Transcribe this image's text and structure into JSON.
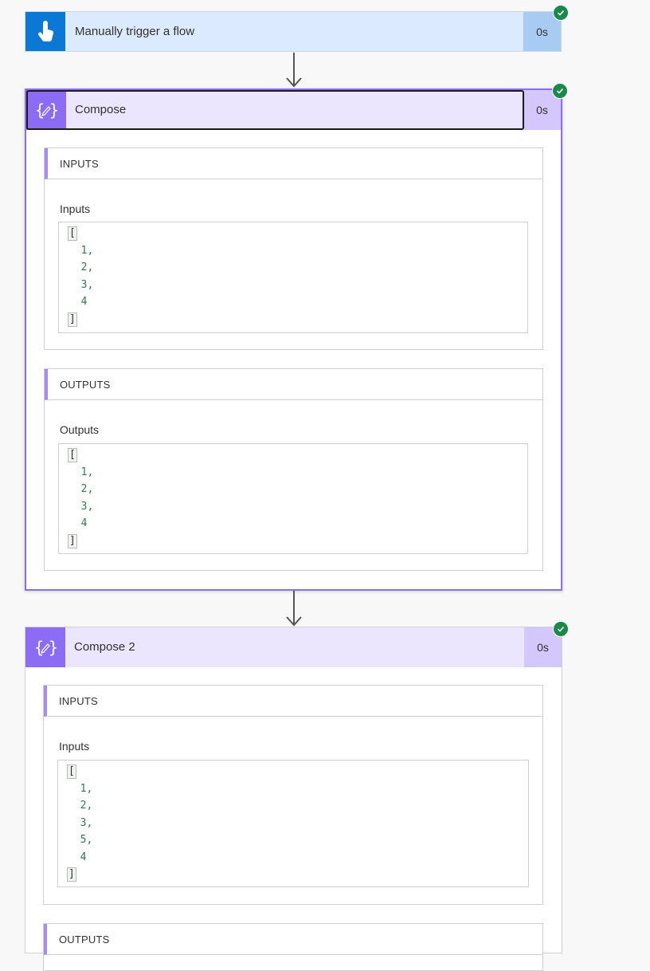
{
  "trigger": {
    "title": "Manually trigger a flow",
    "duration": "0s",
    "status": "succeeded"
  },
  "compose1": {
    "title": "Compose",
    "duration": "0s",
    "inputs": {
      "section": "INPUTS",
      "label": "Inputs",
      "open": "[",
      "items": [
        "1,",
        "2,",
        "3,",
        "4"
      ],
      "close": "]"
    },
    "outputs": {
      "section": "OUTPUTS",
      "label": "Outputs",
      "open": "[",
      "items": [
        "1,",
        "2,",
        "3,",
        "4"
      ],
      "close": "]"
    }
  },
  "compose2": {
    "title": "Compose 2",
    "duration": "0s",
    "inputs": {
      "section": "INPUTS",
      "label": "Inputs",
      "open": "[",
      "items": [
        "1,",
        "2,",
        "3,",
        "5,",
        "4"
      ],
      "close": "]"
    },
    "outputs": {
      "section": "OUTPUTS"
    }
  },
  "colors": {
    "trigger_accent": "#0a78d4",
    "compose_accent": "#8c6cf5",
    "success": "#1a8a4a"
  }
}
